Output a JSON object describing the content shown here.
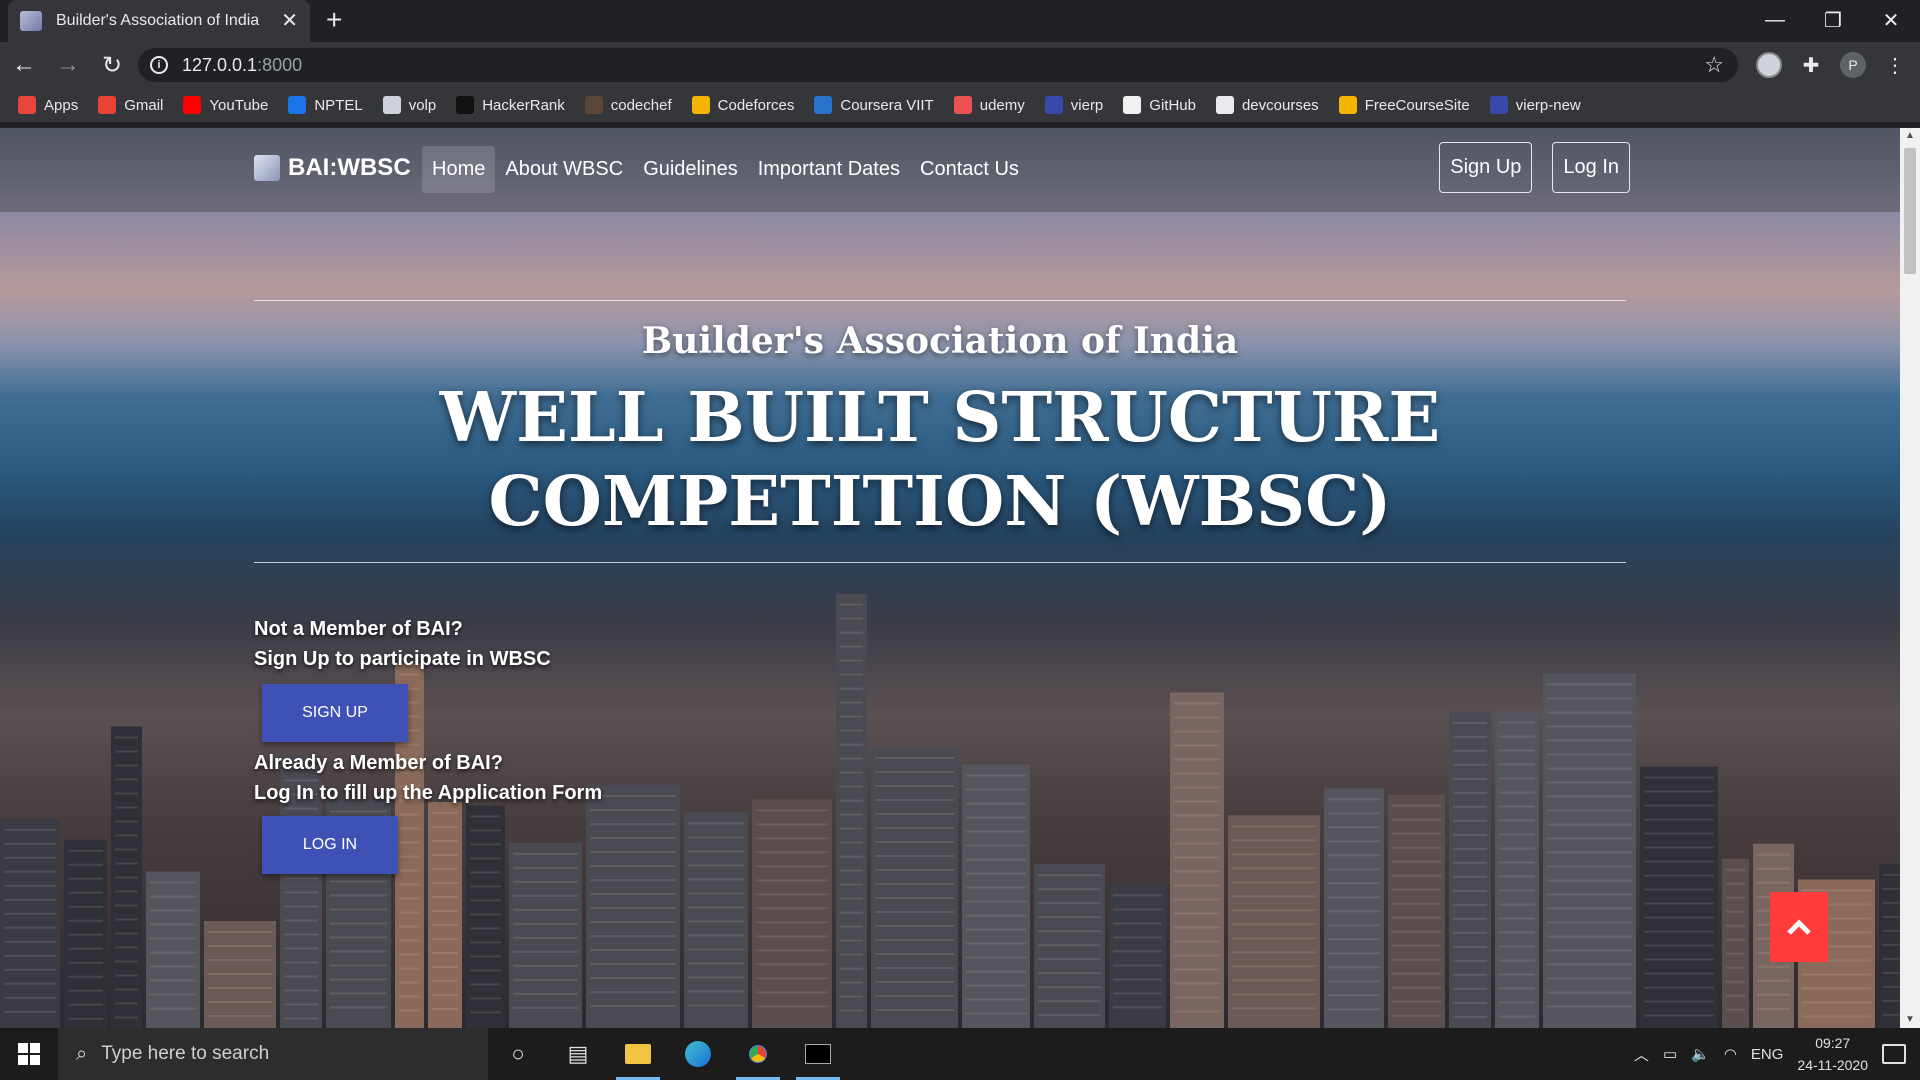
{
  "browser": {
    "tab_title": "Builder's Association of India",
    "url_host": "127.0.0.1",
    "url_port": ":8000",
    "bookmarks": [
      {
        "label": "Apps",
        "icon": "apps-grid-icon",
        "color": "#e8453c"
      },
      {
        "label": "Gmail",
        "icon": "gmail-icon",
        "color": "#ea4335"
      },
      {
        "label": "YouTube",
        "icon": "youtube-icon",
        "color": "#ff0000"
      },
      {
        "label": "NPTEL",
        "icon": "nptel-icon",
        "color": "#1a73e8"
      },
      {
        "label": "volp",
        "icon": "volp-icon",
        "color": "#cfd3da"
      },
      {
        "label": "HackerRank",
        "icon": "hackerrank-icon",
        "color": "#111111"
      },
      {
        "label": "codechef",
        "icon": "codechef-icon",
        "color": "#5b4638"
      },
      {
        "label": "Codeforces",
        "icon": "codeforces-icon",
        "color": "#f4b400"
      },
      {
        "label": "Coursera VIIT",
        "icon": "coursera-icon",
        "color": "#2a73cc"
      },
      {
        "label": "udemy",
        "icon": "udemy-icon",
        "color": "#ec5252"
      },
      {
        "label": "vierp",
        "icon": "vierp-icon",
        "color": "#3949ab"
      },
      {
        "label": "GitHub",
        "icon": "github-icon",
        "color": "#f0f0f0"
      },
      {
        "label": "devcourses",
        "icon": "devcourses-icon",
        "color": "#e8eaed"
      },
      {
        "label": "FreeCourseSite",
        "icon": "freecoursesite-icon",
        "color": "#f4b400"
      },
      {
        "label": "vierp-new",
        "icon": "vierp-new-icon",
        "color": "#3949ab"
      }
    ]
  },
  "navbar": {
    "brand": "BAI:WBSC",
    "links": [
      "Home",
      "About WBSC",
      "Guidelines",
      "Important Dates",
      "Contact Us"
    ],
    "active_link": "Home",
    "signup": "Sign Up",
    "login": "Log In"
  },
  "hero": {
    "subtitle": "Builder's Association of India",
    "title": "WELL BUILT STRUCTURE COMPETITION (WBSC)"
  },
  "cta": {
    "not_member_line1": "Not a Member of BAI?",
    "not_member_line2": "Sign Up to participate in WBSC",
    "signup_button": "SIGN UP",
    "member_line1": "Already a Member of BAI?",
    "member_line2": "Log In to fill up the Application Form",
    "login_button": "LOG IN"
  },
  "taskbar": {
    "search_placeholder": "Type here to search",
    "language": "ENG",
    "time": "09:27",
    "date": "24-11-2020"
  },
  "colors": {
    "primary_button": "#3f51b5",
    "scroll_top_button": "#ff3b3b"
  }
}
